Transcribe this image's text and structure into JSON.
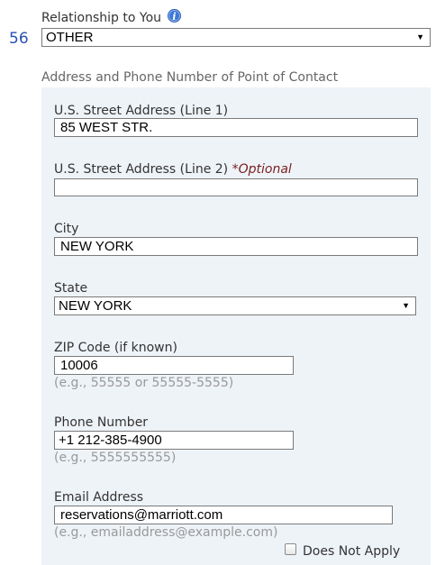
{
  "relationship": {
    "question_number": "56",
    "label": "Relationship to You",
    "selected_value": "OTHER",
    "info_icon": "info-icon"
  },
  "contact_section": {
    "title": "Address and Phone Number of Point of Contact",
    "street1": {
      "label": "U.S. Street Address (Line 1)",
      "value": "85 WEST STR."
    },
    "street2": {
      "label": "U.S. Street Address (Line 2)",
      "optional": "*Optional",
      "value": ""
    },
    "city": {
      "label": "City",
      "value": "NEW YORK"
    },
    "state": {
      "label": "State",
      "selected_value": "NEW YORK"
    },
    "zip": {
      "label": "ZIP Code (if known)",
      "value": "10006",
      "hint": "(e.g., 55555 or 55555-5555)"
    },
    "phone": {
      "label": "Phone Number",
      "value": "+1 212-385-4900",
      "hint": "(e.g., 5555555555)"
    },
    "email": {
      "label": "Email Address",
      "value": "reservations@marriott.com",
      "hint": "(e.g., emailaddress@example.com)",
      "does_not_apply_label": "Does Not Apply",
      "does_not_apply_checked": false
    }
  },
  "colors": {
    "panel_background": "#eef3f8",
    "question_number": "#2b4fb5",
    "optional_text": "#7a2020",
    "hint_text": "#999999"
  }
}
